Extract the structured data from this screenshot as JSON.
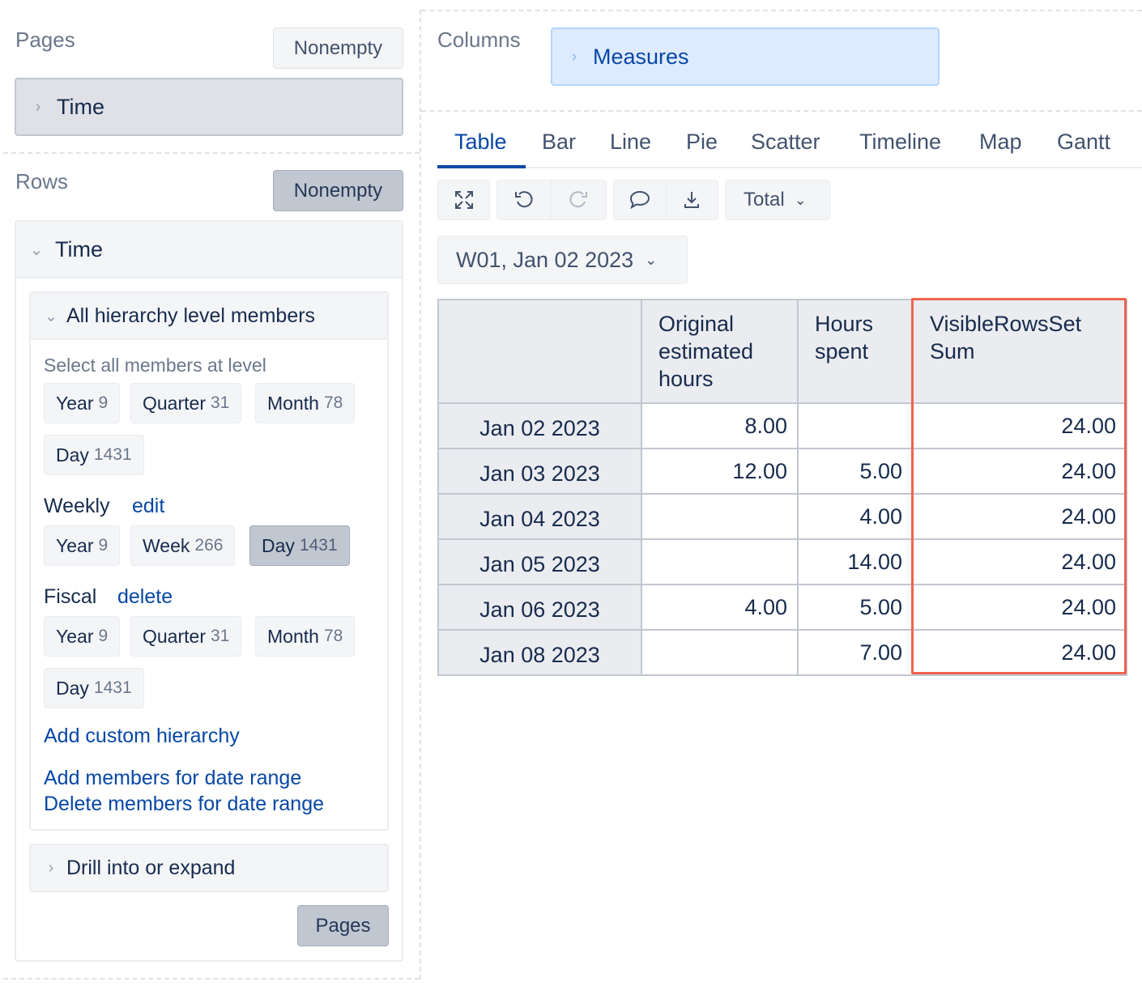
{
  "pages": {
    "title": "Pages",
    "nonempty_label": "Nonempty",
    "dimension": "Time"
  },
  "rows": {
    "title": "Rows",
    "nonempty_label": "Nonempty",
    "dimension": "Time",
    "all_members_title": "All hierarchy level members",
    "select_all_label": "Select all members at level",
    "default_hierarchy": [
      {
        "label": "Year",
        "count": "9"
      },
      {
        "label": "Quarter",
        "count": "31"
      },
      {
        "label": "Month",
        "count": "78"
      },
      {
        "label": "Day",
        "count": "1431"
      }
    ],
    "weekly": {
      "name": "Weekly",
      "action": "edit",
      "levels": [
        {
          "label": "Year",
          "count": "9"
        },
        {
          "label": "Week",
          "count": "266"
        },
        {
          "label": "Day",
          "count": "1431",
          "selected": true
        }
      ]
    },
    "fiscal": {
      "name": "Fiscal",
      "action": "delete",
      "levels": [
        {
          "label": "Year",
          "count": "9"
        },
        {
          "label": "Quarter",
          "count": "31"
        },
        {
          "label": "Month",
          "count": "78"
        },
        {
          "label": "Day",
          "count": "1431"
        }
      ]
    },
    "add_custom_hierarchy": "Add custom hierarchy",
    "add_members_range": "Add members for date range",
    "delete_members_range": "Delete members for date range",
    "drill_label": "Drill into or expand",
    "pages_button": "Pages"
  },
  "columns": {
    "title": "Columns",
    "dimension": "Measures"
  },
  "tabs": [
    "Table",
    "Bar",
    "Line",
    "Pie",
    "Scatter",
    "Timeline",
    "Map",
    "Gantt"
  ],
  "active_tab": "Table",
  "toolbar": {
    "total_label": "Total"
  },
  "page_filter": "W01, Jan 02 2023",
  "table": {
    "headers": [
      "",
      "Original estimated hours",
      "Hours spent",
      "VisibleRowsSet Sum"
    ],
    "rows": [
      [
        "Jan 02 2023",
        "8.00",
        "",
        "24.00"
      ],
      [
        "Jan 03 2023",
        "12.00",
        "5.00",
        "24.00"
      ],
      [
        "Jan 04 2023",
        "",
        "4.00",
        "24.00"
      ],
      [
        "Jan 05 2023",
        "",
        "14.00",
        "24.00"
      ],
      [
        "Jan 06 2023",
        "4.00",
        "5.00",
        "24.00"
      ],
      [
        "Jan 08 2023",
        "",
        "7.00",
        "24.00"
      ]
    ]
  },
  "colors": {
    "accent": "#0747a6",
    "highlight": "#ef6351",
    "measures_bg": "#deebff"
  }
}
